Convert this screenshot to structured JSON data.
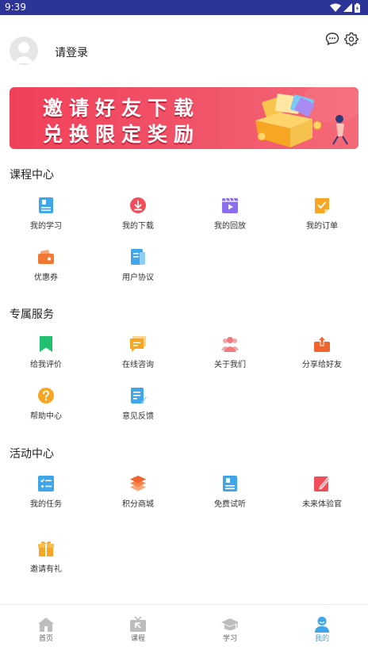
{
  "status_bar": {
    "time": "9:39"
  },
  "header": {
    "login_text": "请登录"
  },
  "banner": {
    "line1": "邀请好友下载",
    "line2": "兑换限定奖励"
  },
  "sections": {
    "course": {
      "title": "课程中心",
      "items": [
        {
          "label": "我的学习",
          "icon": "book-icon",
          "color": "#3fa6ea"
        },
        {
          "label": "我的下载",
          "icon": "download-icon",
          "color": "#f04e5a"
        },
        {
          "label": "我的回放",
          "icon": "play-icon",
          "color": "#8b6df0"
        },
        {
          "label": "我的订单",
          "icon": "order-icon",
          "color": "#f7a623"
        },
        {
          "label": "优惠券",
          "icon": "coupon-icon",
          "color": "#f07a33"
        },
        {
          "label": "用户协议",
          "icon": "document-icon",
          "color": "#3fa6ea"
        }
      ]
    },
    "service": {
      "title": "专属服务",
      "items": [
        {
          "label": "给我评价",
          "icon": "bookmark-icon",
          "color": "#1fc070"
        },
        {
          "label": "在线咨询",
          "icon": "chat-icon",
          "color": "#f7a623"
        },
        {
          "label": "关于我们",
          "icon": "team-icon",
          "color": "#f07a80"
        },
        {
          "label": "分享给好友",
          "icon": "share-icon",
          "color": "#f0642e"
        },
        {
          "label": "帮助中心",
          "icon": "help-icon",
          "color": "#f7a623"
        },
        {
          "label": "意见反馈",
          "icon": "feedback-icon",
          "color": "#3fa6ea"
        }
      ]
    },
    "activity": {
      "title": "活动中心",
      "items": [
        {
          "label": "我的任务",
          "icon": "task-icon",
          "color": "#3fa6ea"
        },
        {
          "label": "积分商城",
          "icon": "layers-icon",
          "color": "#f0642e"
        },
        {
          "label": "免费试听",
          "icon": "listen-icon",
          "color": "#3fa6ea"
        },
        {
          "label": "未来体验官",
          "icon": "edit-icon",
          "color": "#f04e5a"
        },
        {
          "label": "邀请有礼",
          "icon": "gift-icon",
          "color": "#f7a623"
        }
      ]
    }
  },
  "tabbar": {
    "active_color": "#3fa6ea",
    "items": [
      {
        "label": "首页",
        "icon": "home-icon"
      },
      {
        "label": "课程",
        "icon": "tv-icon"
      },
      {
        "label": "学习",
        "icon": "graduation-cap-icon"
      },
      {
        "label": "我的",
        "icon": "user-icon",
        "active": true
      }
    ]
  }
}
